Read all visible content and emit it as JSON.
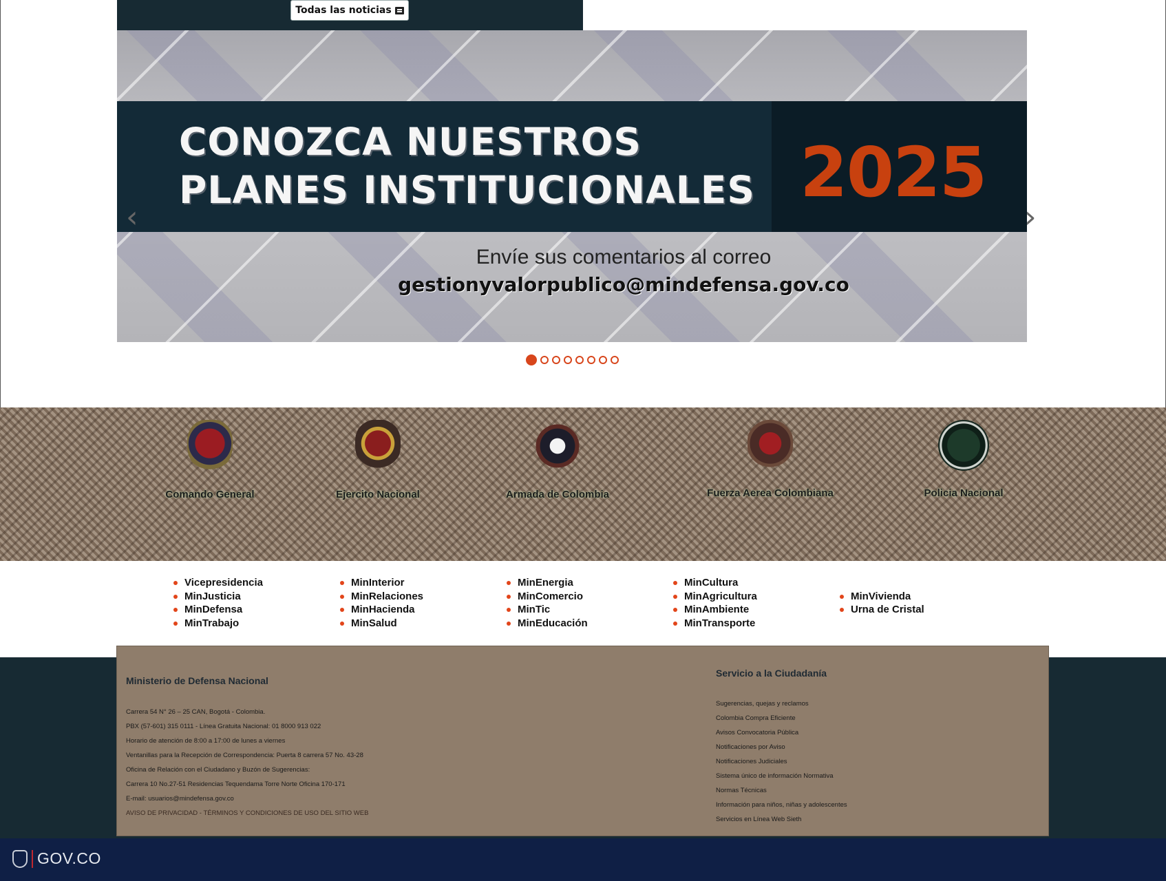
{
  "news": {
    "button_label": "Todas las noticias"
  },
  "banner": {
    "title_line1": "CONOZCA NUESTROS",
    "title_line2": "PLANES INSTITUCIONALES",
    "year": "2025",
    "comment": "Envíe sus comentarios al correo",
    "email": "gestionyvalorpublico@mindefensa.gov.co",
    "prev_arrow": "‹",
    "next_arrow": "›",
    "slide_count": 8,
    "active_slide": 1
  },
  "forces": [
    {
      "name": "Comando General",
      "icon": "comando-general-emblem-icon"
    },
    {
      "name": "Ejercito Nacional",
      "icon": "ejercito-emblem-icon"
    },
    {
      "name": "Armada de Colombia",
      "icon": "armada-emblem-icon"
    },
    {
      "name": "Fuerza Aerea Colombiana",
      "icon": "fac-emblem-icon"
    },
    {
      "name": "Policia Nacional",
      "icon": "policia-emblem-icon"
    }
  ],
  "ministries": {
    "col1": [
      "Vicepresidencia",
      "MinJusticia",
      "MinDefensa",
      "MinTrabajo"
    ],
    "col2": [
      "MinInterior",
      "MinRelaciones",
      "MinHacienda",
      "MinSalud"
    ],
    "col3": [
      "MinEnergia",
      "MinComercio",
      "MinTic",
      "MinEducación"
    ],
    "col4": [
      "MinCultura",
      "MinAgricultura",
      "MinAmbiente",
      "MinTransporte"
    ],
    "col5": [
      "MinVivienda",
      "Urna de Cristal"
    ]
  },
  "footer": {
    "org": "Ministerio de Defensa Nacional",
    "lines": [
      "Carrera 54 N° 26 – 25 CAN, Bogotá - Colombia.",
      "PBX (57-601) 315 0111 - Línea Gratuita Nacional: 01 8000 913 022",
      "Horario de atención de 8:00 a 17:00 de lunes a viernes",
      "Ventanillas para la Recepción de Correspondencia: Puerta 8 carrera 57 No. 43-28",
      "Oficina de Relación con el Ciudadano y Buzón de Sugerencias:",
      "Carrera 10 No.27-51 Residencias Tequendama Torre Norte Oficina 170-171",
      "E-mail: usuarios@mindefensa.gov.co",
      "AVISO DE PRIVACIDAD - TÉRMINOS Y CONDICIONES DE USO DEL SITIO WEB"
    ],
    "service_title": "Servicio a la Ciudadanía",
    "service_links": [
      "Sugerencias, quejas y reclamos",
      "Colombia Compra Eficiente",
      "Avisos Convocatoria Pública",
      "Notificaciones por Aviso",
      "Notificaciones Judiciales",
      "Sistema único de información Normativa",
      "Normas Técnicas",
      "Información para niños, niñas y adolescentes",
      "Servicios en Línea Web Sieth"
    ]
  },
  "govbar": {
    "label": "GOV.CO"
  },
  "colors": {
    "accent": "#d8461c",
    "dark": "#172a33",
    "footer_bg": "#8f7d6b",
    "gov_bar": "#0f1f45"
  }
}
